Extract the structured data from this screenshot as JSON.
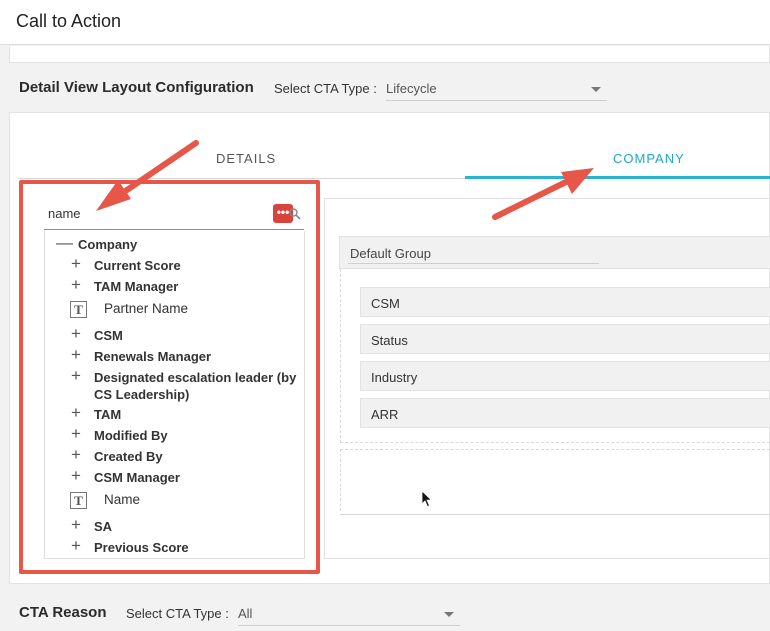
{
  "header": {
    "title": "Call to Action"
  },
  "detail_section": {
    "title": "Detail View Layout Configuration",
    "cta_type_label": "Select CTA Type :",
    "cta_type_value": "Lifecycle"
  },
  "tabs": [
    {
      "label": "DETAILS",
      "active": false
    },
    {
      "label": "COMPANY",
      "active": true
    }
  ],
  "search": {
    "value": "name"
  },
  "tree": {
    "root": "Company",
    "items": [
      {
        "label": "Current Score",
        "kind": "expandable"
      },
      {
        "label": "TAM Manager",
        "kind": "expandable"
      },
      {
        "label": "Partner Name",
        "kind": "text"
      },
      {
        "label": "CSM",
        "kind": "expandable"
      },
      {
        "label": "Renewals Manager",
        "kind": "expandable"
      },
      {
        "label": "Designated escalation leader (by CS Leadership)",
        "kind": "expandable"
      },
      {
        "label": "TAM",
        "kind": "expandable"
      },
      {
        "label": "Modified By",
        "kind": "expandable"
      },
      {
        "label": "Created By",
        "kind": "expandable"
      },
      {
        "label": "CSM Manager",
        "kind": "expandable"
      },
      {
        "label": "Name",
        "kind": "text"
      },
      {
        "label": "SA",
        "kind": "expandable"
      },
      {
        "label": "Previous Score",
        "kind": "expandable"
      }
    ]
  },
  "layout_group": {
    "name": "Default Group",
    "fields": [
      "CSM",
      "Status",
      "Industry",
      "ARR"
    ]
  },
  "reason_section": {
    "title": "CTA Reason",
    "cta_type_label": "Select CTA Type :",
    "cta_type_value": "All"
  },
  "colors": {
    "accent": "#2bb3d4",
    "annotation": "#e6574a",
    "extension_icon": "#d9443a"
  }
}
